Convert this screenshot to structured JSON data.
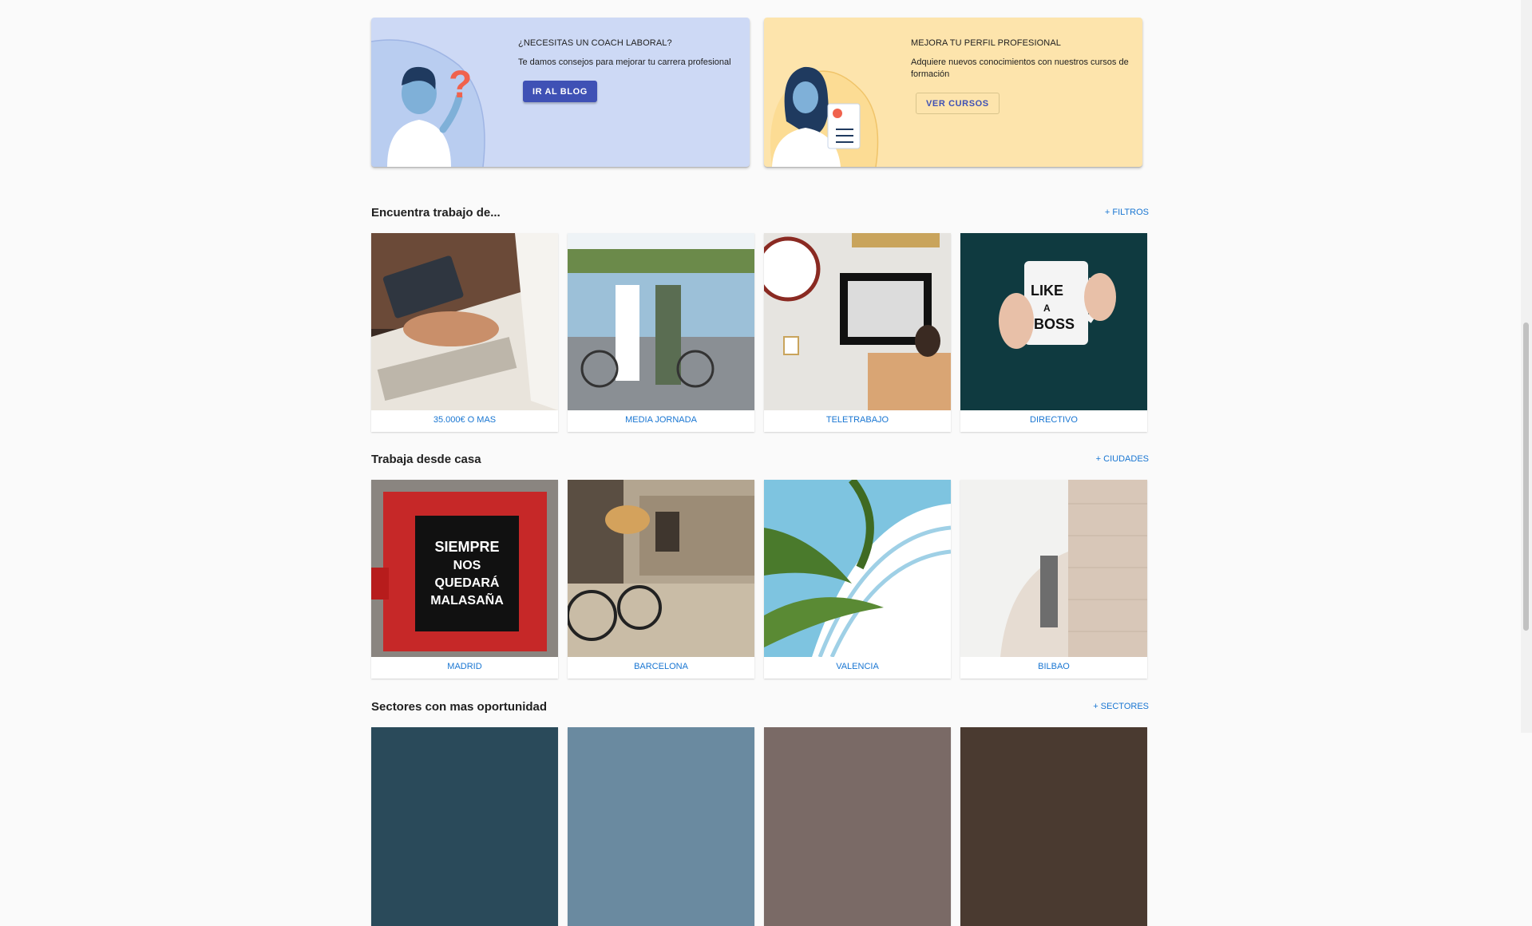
{
  "banners": [
    {
      "title": "¿NECESITAS UN COACH LABORAL?",
      "subtitle": "Te damos consejos para mejorar tu carrera profesional",
      "button": "IR AL BLOG",
      "background": "#cdd9f5"
    },
    {
      "title": "MEJORA TU PERFIL PROFESIONAL",
      "subtitle": "Adquiere nuevos conocimientos con nuestros cursos de formación",
      "button": "VER CURSOS",
      "background": "#fde4ac"
    }
  ],
  "sections": {
    "jobs": {
      "title": "Encuentra trabajo de...",
      "link": "+ FILTROS",
      "cards": [
        "35.000€ O MAS",
        "MEDIA JORNADA",
        "TELETRABAJO",
        "DIRECTIVO"
      ]
    },
    "home": {
      "title": "Trabaja desde casa",
      "link": "+ CIUDADES",
      "cards": [
        "MADRID",
        "BARCELONA",
        "VALENCIA",
        "BILBAO"
      ]
    },
    "sectors": {
      "title": "Sectores con mas oportunidad",
      "link": "+ SECTORES"
    }
  },
  "colors": {
    "accent": "#3f51b5",
    "link": "#1976d2",
    "background": "#fafafa"
  }
}
